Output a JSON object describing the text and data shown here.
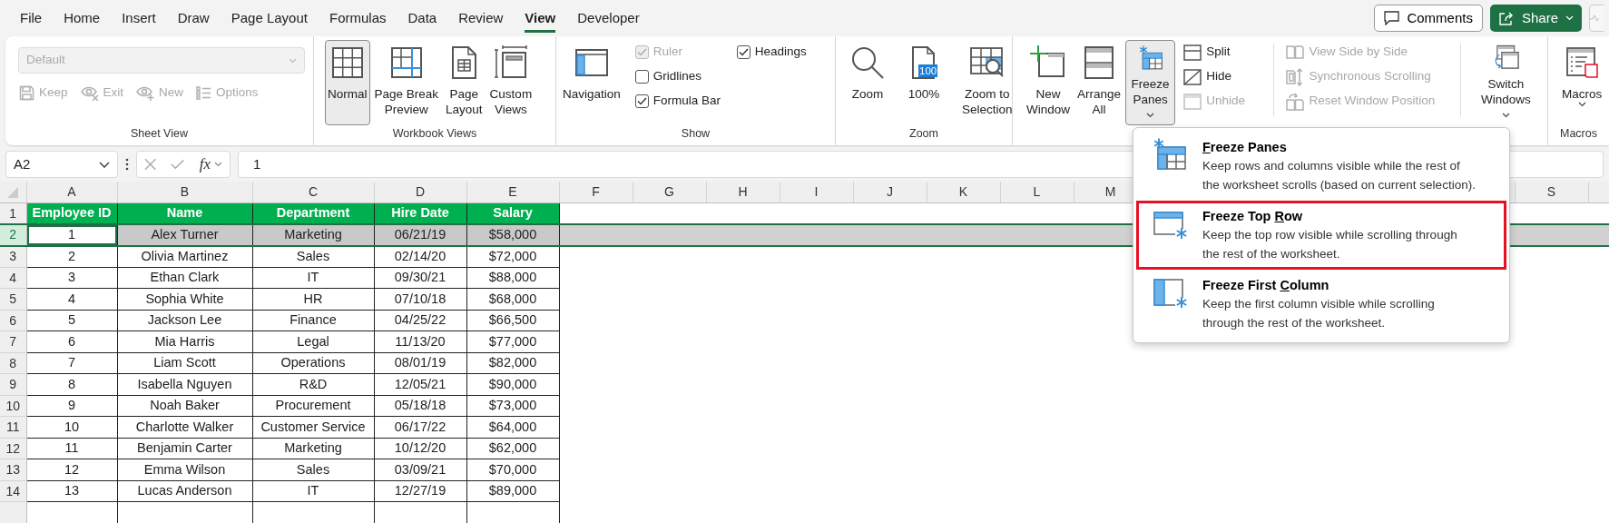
{
  "menu_tabs": [
    {
      "label": "File",
      "selected": false
    },
    {
      "label": "Home",
      "selected": false
    },
    {
      "label": "Insert",
      "selected": false
    },
    {
      "label": "Draw",
      "selected": false
    },
    {
      "label": "Page Layout",
      "selected": false
    },
    {
      "label": "Formulas",
      "selected": false
    },
    {
      "label": "Data",
      "selected": false
    },
    {
      "label": "Review",
      "selected": false
    },
    {
      "label": "View",
      "selected": true
    },
    {
      "label": "Developer",
      "selected": false
    }
  ],
  "top_buttons": {
    "comments": "Comments",
    "share": "Share"
  },
  "ribbon": {
    "sheet_view": {
      "dropdown": {
        "value": "Default",
        "disabled": true
      },
      "buttons": [
        {
          "label": "Keep",
          "disabled": true
        },
        {
          "label": "Exit",
          "disabled": true
        },
        {
          "label": "New",
          "disabled": true
        },
        {
          "label": "Options",
          "disabled": true
        }
      ],
      "label": "Sheet View"
    },
    "workbook_views": {
      "buttons": [
        {
          "lines": [
            "Normal"
          ],
          "selected": true
        },
        {
          "lines": [
            "Page Break",
            "Preview"
          ],
          "selected": false
        },
        {
          "lines": [
            "Page",
            "Layout"
          ],
          "selected": false
        },
        {
          "lines": [
            "Custom",
            "Views"
          ],
          "selected": false
        }
      ],
      "label": "Workbook Views"
    },
    "show": {
      "navigation": "Navigation",
      "checkboxes": [
        {
          "label": "Ruler",
          "checked": true,
          "disabled": true
        },
        {
          "label": "Gridlines",
          "checked": false,
          "disabled": false
        },
        {
          "label": "Formula Bar",
          "checked": true,
          "disabled": false
        },
        {
          "label": "Headings",
          "checked": true,
          "disabled": false
        }
      ],
      "label": "Show"
    },
    "zoom": {
      "buttons": [
        {
          "lines": [
            "Zoom"
          ]
        },
        {
          "lines": [
            "100%"
          ],
          "badge": "100"
        },
        {
          "lines": [
            "Zoom to",
            "Selection"
          ]
        }
      ],
      "label": "Zoom"
    },
    "window": {
      "large_buttons": [
        {
          "lines": [
            "New",
            "Window"
          ],
          "pressed": false
        },
        {
          "lines": [
            "Arrange",
            "All"
          ],
          "pressed": false
        },
        {
          "lines": [
            "Freeze",
            "Panes"
          ],
          "pressed": true
        }
      ],
      "small_buttons": [
        {
          "label": "Split",
          "disabled": false
        },
        {
          "label": "Hide",
          "disabled": false
        },
        {
          "label": "Unhide",
          "disabled": true
        }
      ],
      "side_buttons": [
        {
          "label": "View Side by Side",
          "disabled": true
        },
        {
          "label": "Synchronous Scrolling",
          "disabled": true
        },
        {
          "label": "Reset Window Position",
          "disabled": true
        }
      ],
      "switch": {
        "lines": [
          "Switch",
          "Windows"
        ]
      }
    },
    "macros": {
      "button": "Macros",
      "label": "Macros"
    }
  },
  "formula_bar": {
    "name_box": "A2",
    "function_label": "fx",
    "formula": "1"
  },
  "sheet": {
    "columns": [
      "A",
      "B",
      "C",
      "D",
      "E",
      "F",
      "G",
      "H",
      "I",
      "J",
      "K",
      "L",
      "M"
    ],
    "far_columns": [
      "S"
    ],
    "rows": [
      {
        "header": "1",
        "kind": "header",
        "selected": false,
        "cells": [
          "Employee ID",
          "Name",
          "Department",
          "Hire Date",
          "Salary"
        ]
      },
      {
        "header": "2",
        "kind": "data",
        "selected": true,
        "cells": [
          "1",
          "Alex Turner",
          "Marketing",
          "06/21/19",
          "$58,000"
        ]
      },
      {
        "header": "3",
        "kind": "data",
        "selected": false,
        "cells": [
          "2",
          "Olivia Martinez",
          "Sales",
          "02/14/20",
          "$72,000"
        ]
      },
      {
        "header": "4",
        "kind": "data",
        "selected": false,
        "cells": [
          "3",
          "Ethan Clark",
          "IT",
          "09/30/21",
          "$88,000"
        ]
      },
      {
        "header": "5",
        "kind": "data",
        "selected": false,
        "cells": [
          "4",
          "Sophia White",
          "HR",
          "07/10/18",
          "$68,000"
        ]
      },
      {
        "header": "6",
        "kind": "data",
        "selected": false,
        "cells": [
          "5",
          "Jackson Lee",
          "Finance",
          "04/25/22",
          "$66,500"
        ]
      },
      {
        "header": "7",
        "kind": "data",
        "selected": false,
        "cells": [
          "6",
          "Mia Harris",
          "Legal",
          "11/13/20",
          "$77,000"
        ]
      },
      {
        "header": "8",
        "kind": "data",
        "selected": false,
        "cells": [
          "7",
          "Liam Scott",
          "Operations",
          "08/01/19",
          "$82,000"
        ]
      },
      {
        "header": "9",
        "kind": "data",
        "selected": false,
        "cells": [
          "8",
          "Isabella Nguyen",
          "R&D",
          "12/05/21",
          "$90,000"
        ]
      },
      {
        "header": "10",
        "kind": "data",
        "selected": false,
        "cells": [
          "9",
          "Noah Baker",
          "Procurement",
          "05/18/18",
          "$73,000"
        ]
      },
      {
        "header": "11",
        "kind": "data",
        "selected": false,
        "cells": [
          "10",
          "Charlotte Walker",
          "Customer Service",
          "06/17/22",
          "$64,000"
        ]
      },
      {
        "header": "12",
        "kind": "data",
        "selected": false,
        "cells": [
          "11",
          "Benjamin Carter",
          "Marketing",
          "10/12/20",
          "$62,000"
        ]
      },
      {
        "header": "13",
        "kind": "data",
        "selected": false,
        "cells": [
          "12",
          "Emma Wilson",
          "Sales",
          "03/09/21",
          "$70,000"
        ]
      },
      {
        "header": "14",
        "kind": "data",
        "selected": false,
        "cells": [
          "13",
          "Lucas Anderson",
          "IT",
          "12/27/19",
          "$89,000"
        ]
      }
    ]
  },
  "freeze_menu": {
    "items": [
      {
        "access_key": "F",
        "title_end": "reeze Panes",
        "description": [
          "Keep rows and columns visible while the rest of",
          "the worksheet scrolls (based on current selection)."
        ],
        "selected": false
      },
      {
        "title_start": "Freeze Top ",
        "access_key": "R",
        "title_end": "ow",
        "description": [
          "Keep the top row visible while scrolling through",
          "the rest of the worksheet."
        ],
        "selected": true
      },
      {
        "title_start": "Freeze First ",
        "access_key": "C",
        "title_end": "olumn",
        "description": [
          "Keep the first column visible while scrolling",
          "through the rest of the worksheet."
        ],
        "selected": false
      }
    ]
  }
}
